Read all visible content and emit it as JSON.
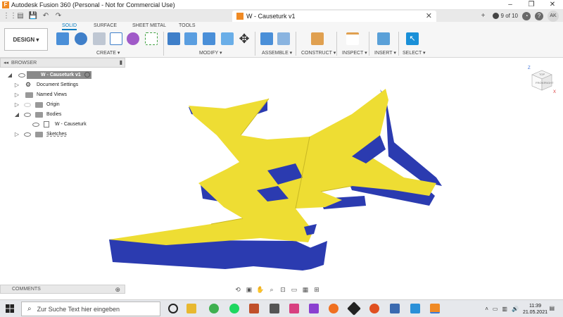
{
  "window": {
    "title": "Autodesk Fusion 360 (Personal - Not for Commercial Use)",
    "controls": [
      "minimize-icon",
      "maximize-icon",
      "close-icon"
    ]
  },
  "doc_tab": {
    "title": "W - Causeturk v1",
    "job_status": "9 of 10",
    "avatar": "AK"
  },
  "workspace": {
    "selector": "DESIGN ▾",
    "tabs": [
      "SOLID",
      "SURFACE",
      "SHEET METAL",
      "TOOLS"
    ],
    "active_tab": "SOLID"
  },
  "toolbar_groups": [
    {
      "label": "CREATE ▾"
    },
    {
      "label": "MODIFY ▾"
    },
    {
      "label": "ASSEMBLE ▾"
    },
    {
      "label": "CONSTRUCT ▾"
    },
    {
      "label": "INSPECT ▾"
    },
    {
      "label": "INSERT ▾"
    },
    {
      "label": "SELECT ▾"
    }
  ],
  "browser": {
    "header": "BROWSER",
    "root": "W - Causeturk v1",
    "items": [
      {
        "label": "Document Settings"
      },
      {
        "label": "Named Views"
      },
      {
        "label": "Origin"
      },
      {
        "label": "Bodies"
      },
      {
        "label": "W - Causeturk"
      },
      {
        "label": "Sketches"
      }
    ]
  },
  "comments": {
    "label": "COMMENTS"
  },
  "viewcube": {
    "front": "FRONT",
    "right": "RIGHT",
    "top": "TOP"
  },
  "model_colors": {
    "top_face": "#eedd33",
    "side_face": "#2b3bb0"
  },
  "taskbar": {
    "search_placeholder": "Zur Suche Text hier eingeben",
    "time": "11:39",
    "date": "21.05.2021"
  }
}
